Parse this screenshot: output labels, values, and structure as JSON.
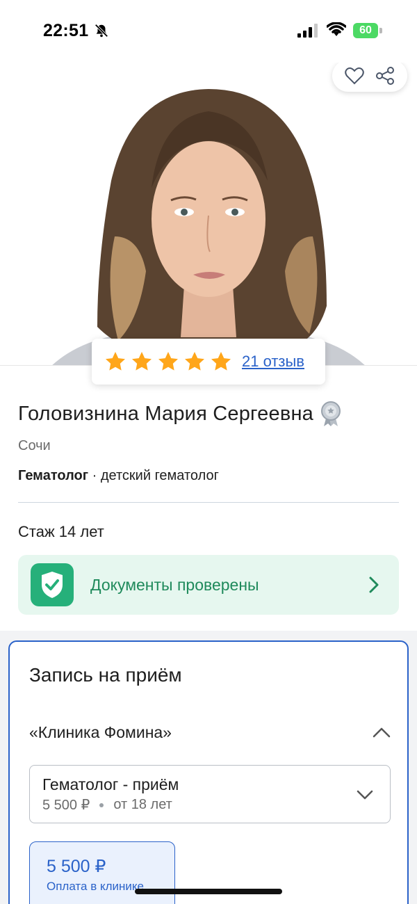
{
  "status_bar": {
    "time": "22:51",
    "battery_level": "60",
    "icons": [
      "bell-off-icon",
      "signal-icon",
      "wifi-icon",
      "battery-charging-icon"
    ]
  },
  "hero": {
    "actions": [
      "heart-icon",
      "share-icon"
    ]
  },
  "rating": {
    "stars": 5,
    "star_color": "#ffa61a",
    "reviews_link": "21 отзыв"
  },
  "profile": {
    "name": "Головизнина Мария Сергеевна",
    "city": "Сочи",
    "specialty_main": "Гематолог",
    "specialty_extra": " · детский гематолог",
    "experience": "Стаж 14 лет",
    "documents_label": "Документы проверены"
  },
  "booking": {
    "title": "Запись на приём",
    "clinic": "«Клиника Фомина»",
    "service": {
      "name": "Гематолог - приём",
      "price": "5 500 ₽",
      "age": "от 18 лет"
    },
    "price_card": {
      "price": "5 500 ₽",
      "label": "Оплата в клинике"
    }
  },
  "colors": {
    "accent_blue": "#2a62c9",
    "verified_green": "#26b07a",
    "verified_bg": "#e6f7ef"
  }
}
